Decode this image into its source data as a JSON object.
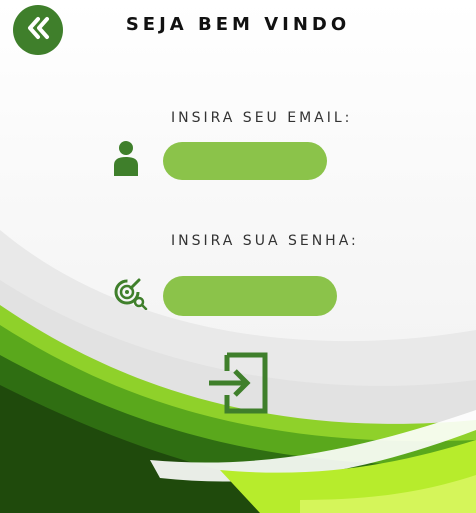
{
  "header": {
    "title": "SEJA BEM VINDO"
  },
  "form": {
    "email_label": "INSIRA SEU EMAIL:",
    "email_value": "",
    "senha_label": "INSIRA SUA SENHA:",
    "senha_value": ""
  },
  "icons": {
    "back": "double-chevron-left-icon",
    "user": "user-icon",
    "password": "key-lock-icon",
    "login": "login-enter-icon"
  },
  "colors": {
    "primary": "#3f7f2b",
    "field": "#8bc34a",
    "accent_light": "#a6e22e"
  }
}
